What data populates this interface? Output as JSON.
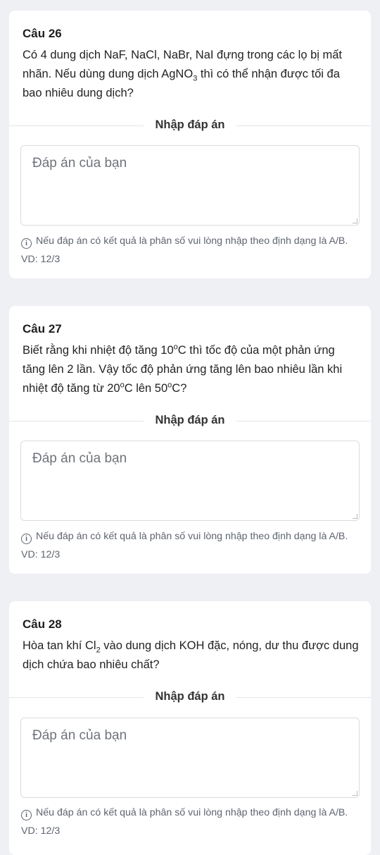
{
  "questions": [
    {
      "title": "Câu 26",
      "text_html": "Có 4 dung dịch NaF, NaCl, NaBr, NaI đựng trong các lọ bị mất nhãn. Nếu dùng dung dịch AgNO<sub>3</sub> thì có thể nhận được tối đa bao nhiêu dung dịch?",
      "section_label": "Nhập đáp án",
      "placeholder": "Đáp án của bạn",
      "hint": "Nếu đáp án có kết quả là phân số vui lòng nhập theo định dạng là A/B. VD: 12/3"
    },
    {
      "title": "Câu 27",
      "text_html": "Biết rằng khi nhiệt độ tăng 10<sup>o</sup>C thì tốc độ của một phản ứng tăng lên 2 lần. Vậy tốc độ phản ứng tăng lên bao nhiêu lần khi nhiệt độ tăng từ 20<sup>o</sup>C lên 50<sup>o</sup>C?",
      "section_label": "Nhập đáp án",
      "placeholder": "Đáp án của bạn",
      "hint": "Nếu đáp án có kết quả là phân số vui lòng nhập theo định dạng là A/B. VD: 12/3"
    },
    {
      "title": "Câu 28",
      "text_html": "Hòa tan khí Cl<sub>2</sub> vào dung dịch KOH đặc, nóng, dư thu được dung dịch chứa bao nhiêu chất?",
      "section_label": "Nhập đáp án",
      "placeholder": "Đáp án của bạn",
      "hint": "Nếu đáp án có kết quả là phân số vui lòng nhập theo định dạng là A/B. VD: 12/3"
    }
  ],
  "icons": {
    "info": "info-circle-icon"
  },
  "colors": {
    "background": "#eef0f4",
    "card": "#ffffff",
    "hint_text": "#5f6470",
    "placeholder": "#6f737a"
  }
}
